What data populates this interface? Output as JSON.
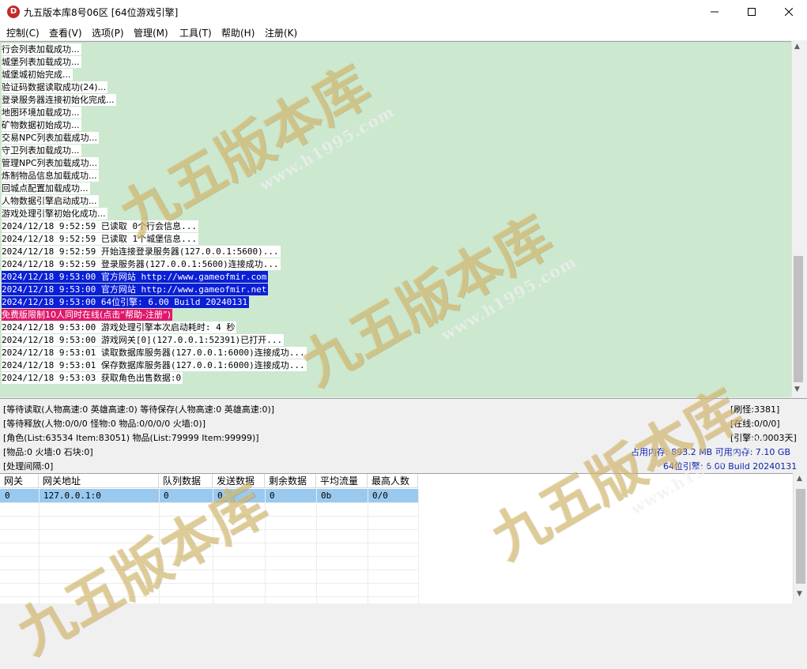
{
  "window": {
    "title": "九五版本库8号06区 [64位游戏引擎]",
    "icon_letter": "D"
  },
  "menu": [
    {
      "label": "控制(C)"
    },
    {
      "label": "查看(V)"
    },
    {
      "label": "选项(P)"
    },
    {
      "label": "管理(M)"
    },
    {
      "label": "工具(T)"
    },
    {
      "label": "帮助(H)"
    },
    {
      "label": "注册(K)"
    }
  ],
  "log": [
    {
      "text": "行会列表加载成功...",
      "style": "cn"
    },
    {
      "text": "城堡列表加载成功...",
      "style": "cn"
    },
    {
      "text": "城堡城初始完成...",
      "style": "cn"
    },
    {
      "text": "验证码数据读取成功(24)...",
      "style": "cn"
    },
    {
      "text": "登录服务器连接初始化完成...",
      "style": "cn"
    },
    {
      "text": "地图环境加载成功...",
      "style": "cn"
    },
    {
      "text": "矿物数据初始成功...",
      "style": "cn"
    },
    {
      "text": "交易NPC列表加载成功...",
      "style": "cn"
    },
    {
      "text": "守卫列表加载成功...",
      "style": "cn"
    },
    {
      "text": "管理NPC列表加载成功...",
      "style": "cn"
    },
    {
      "text": "炼制物品信息加载成功...",
      "style": "cn"
    },
    {
      "text": "回城点配置加载成功...",
      "style": "cn"
    },
    {
      "text": "人物数据引擎启动成功...",
      "style": "cn"
    },
    {
      "text": "游戏处理引擎初始化成功...",
      "style": "cn"
    },
    {
      "text": "2024/12/18 9:52:59 已读取 0个行会信息...",
      "style": "normal"
    },
    {
      "text": "2024/12/18 9:52:59 已读取 1个城堡信息...",
      "style": "normal"
    },
    {
      "text": "2024/12/18 9:52:59 开始连接登录服务器(127.0.0.1:5600)...",
      "style": "normal"
    },
    {
      "text": "2024/12/18 9:52:59 登录服务器(127.0.0.1:5600)连接成功...",
      "style": "normal"
    },
    {
      "text": "2024/12/18 9:53:00 官方网站 http://www.gameofmir.com",
      "style": "hl"
    },
    {
      "text": "2024/12/18 9:53:00 官方网站 http://www.gameofmir.net",
      "style": "hl"
    },
    {
      "text": "2024/12/18 9:53:00 64位引擎: 6.00 Build 20240131",
      "style": "hl"
    },
    {
      "text": "免费版限制10人同时在线(点击“帮助-注册”)",
      "style": "warn"
    },
    {
      "text": "2024/12/18 9:53:00 游戏处理引擎本次启动耗时: 4 秒",
      "style": "normal"
    },
    {
      "text": "2024/12/18 9:53:00 游戏网关[0](127.0.0.1:52391)已打开...",
      "style": "normal"
    },
    {
      "text": "2024/12/18 9:53:01 读取数据库服务器(127.0.0.1:6000)连接成功...",
      "style": "normal"
    },
    {
      "text": "2024/12/18 9:53:01 保存数据库服务器(127.0.0.1:6000)连接成功...",
      "style": "normal"
    },
    {
      "text": "2024/12/18 9:53:03 获取角色出售数据:0",
      "style": "normal"
    }
  ],
  "status": {
    "line1": "[等待读取(人物高速:0 英雄高速:0) 等待保存(人物高速:0 英雄高速:0)]",
    "line2": "[等待释放(人物:0/0/0 怪物:0 物品:0/0/0/0 火墙:0)]",
    "line3": "[角色(List:63534 Item:83051) 物品(List:79999 Item:99999)]",
    "line4": "[物品:0 火墙:0 石块:0]",
    "line5": "[处理间隔:0]",
    "refresh": "[刷怪:3381]",
    "online": "[在线:0/0/0]",
    "engine": "[引擎:0.0003天]",
    "memory": "占用内存: 893.2 MB 可用内存: 7.10 GB",
    "build": "64位引擎: 6.00 Build 20240131"
  },
  "gateway_table": {
    "columns": [
      "网关",
      "网关地址",
      "队列数据",
      "发送数据",
      "剩余数据",
      "平均流量",
      "最高人数"
    ],
    "rows": [
      [
        "0",
        "127.0.0.1:0",
        "0",
        "0",
        "0",
        "0b",
        "0/0"
      ]
    ]
  },
  "watermark": {
    "text": "九五版本库",
    "url": "www.h1995.com"
  },
  "colors": {
    "log_bg": "#cce8cf",
    "highlight": "#0a1fd6",
    "warning": "#e0186c",
    "selected_row": "#99c9ef",
    "status_blue": "#0a1fb0"
  }
}
